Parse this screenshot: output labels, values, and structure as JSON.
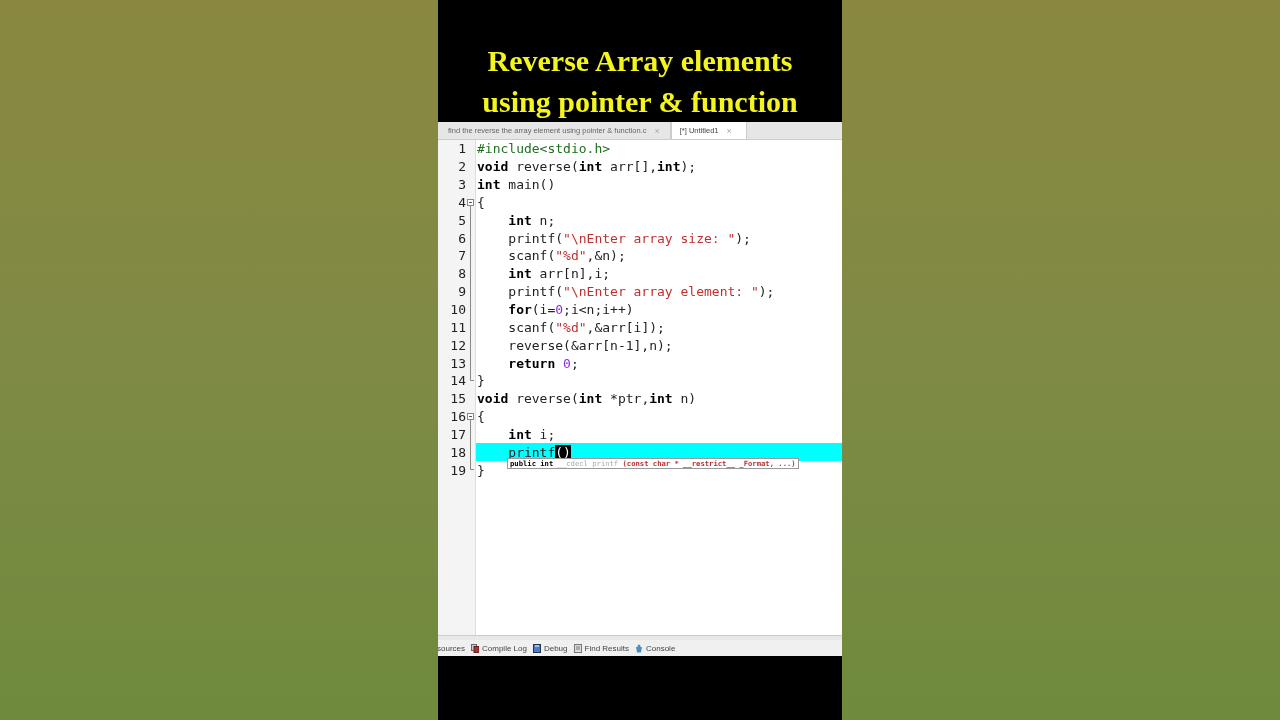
{
  "title_lines": [
    "Reverse Array elements",
    "using pointer & function"
  ],
  "editor_tabs": [
    {
      "label": "find the reverse the array element using pointer & function.c",
      "close": "×",
      "selected": false
    },
    {
      "label": "[*] Untitled1",
      "close": "×",
      "selected": true
    }
  ],
  "code_lines": [
    {
      "number": "1",
      "kind": "plain",
      "highlighted": false,
      "tokens": [
        {
          "kind": "pp",
          "text": "#include<stdio.h>"
        }
      ]
    },
    {
      "number": "2",
      "kind": "plain",
      "highlighted": false,
      "tokens": [
        {
          "kind": "kw",
          "text": "void"
        },
        {
          "kind": "plain",
          "text": " reverse("
        },
        {
          "kind": "kw",
          "text": "int"
        },
        {
          "kind": "plain",
          "text": " arr[],"
        },
        {
          "kind": "kw",
          "text": "int"
        },
        {
          "kind": "plain",
          "text": ");"
        }
      ]
    },
    {
      "number": "3",
      "kind": "plain",
      "highlighted": false,
      "tokens": [
        {
          "kind": "kw",
          "text": "int"
        },
        {
          "kind": "plain",
          "text": " main()"
        }
      ]
    },
    {
      "number": "4",
      "kind": "fold-start",
      "highlighted": false,
      "tokens": [
        {
          "kind": "plain",
          "text": "{"
        }
      ]
    },
    {
      "number": "5",
      "kind": "fold-body",
      "highlighted": false,
      "tokens": [
        {
          "kind": "kw",
          "text": "    int"
        },
        {
          "kind": "plain",
          "text": " n;"
        }
      ]
    },
    {
      "number": "6",
      "kind": "fold-body",
      "highlighted": false,
      "tokens": [
        {
          "kind": "plain",
          "text": "    printf("
        },
        {
          "kind": "str",
          "text": "\"\\nEnter array size: \""
        },
        {
          "kind": "plain",
          "text": ");"
        }
      ]
    },
    {
      "number": "7",
      "kind": "fold-body",
      "highlighted": false,
      "tokens": [
        {
          "kind": "plain",
          "text": "    scanf("
        },
        {
          "kind": "str",
          "text": "\"%d\""
        },
        {
          "kind": "plain",
          "text": ",&n);"
        }
      ]
    },
    {
      "number": "8",
      "kind": "fold-body",
      "highlighted": false,
      "tokens": [
        {
          "kind": "kw",
          "text": "    int"
        },
        {
          "kind": "plain",
          "text": " arr[n],i;"
        }
      ]
    },
    {
      "number": "9",
      "kind": "fold-body",
      "highlighted": false,
      "tokens": [
        {
          "kind": "plain",
          "text": "    printf("
        },
        {
          "kind": "str",
          "text": "\"\\nEnter array element: \""
        },
        {
          "kind": "plain",
          "text": ");"
        }
      ]
    },
    {
      "number": "10",
      "kind": "fold-body",
      "highlighted": false,
      "tokens": [
        {
          "kind": "kw",
          "text": "    for"
        },
        {
          "kind": "plain",
          "text": "(i="
        },
        {
          "kind": "num",
          "text": "0"
        },
        {
          "kind": "plain",
          "text": ";i<n;i++)"
        }
      ]
    },
    {
      "number": "11",
      "kind": "fold-body",
      "highlighted": false,
      "tokens": [
        {
          "kind": "plain",
          "text": "    scanf("
        },
        {
          "kind": "str",
          "text": "\"%d\""
        },
        {
          "kind": "plain",
          "text": ",&arr[i]);"
        }
      ]
    },
    {
      "number": "12",
      "kind": "fold-body",
      "highlighted": false,
      "tokens": [
        {
          "kind": "plain",
          "text": "    reverse(&arr[n-1],n);"
        }
      ]
    },
    {
      "number": "13",
      "kind": "fold-body",
      "highlighted": false,
      "tokens": [
        {
          "kind": "kw",
          "text": "    return "
        },
        {
          "kind": "num",
          "text": "0"
        },
        {
          "kind": "plain",
          "text": ";"
        }
      ]
    },
    {
      "number": "14",
      "kind": "fold-end",
      "highlighted": false,
      "tokens": [
        {
          "kind": "plain",
          "text": "}"
        }
      ]
    },
    {
      "number": "15",
      "kind": "plain",
      "highlighted": false,
      "tokens": [
        {
          "kind": "kw",
          "text": "void"
        },
        {
          "kind": "plain",
          "text": " reverse("
        },
        {
          "kind": "kw",
          "text": "int"
        },
        {
          "kind": "plain",
          "text": " *ptr,"
        },
        {
          "kind": "kw",
          "text": "int"
        },
        {
          "kind": "plain",
          "text": " n)"
        }
      ]
    },
    {
      "number": "16",
      "kind": "fold-start",
      "highlighted": false,
      "tokens": [
        {
          "kind": "plain",
          "text": "{"
        }
      ]
    },
    {
      "number": "17",
      "kind": "fold-body",
      "highlighted": false,
      "tokens": [
        {
          "kind": "kw",
          "text": "    int"
        },
        {
          "kind": "plain",
          "text": " i;"
        }
      ]
    },
    {
      "number": "18",
      "kind": "fold-body",
      "highlighted": true,
      "tokens": [
        {
          "kind": "plain",
          "text": "    printf"
        },
        {
          "kind": "cursor",
          "text": "()"
        }
      ],
      "tooltip": [
        {
          "kind": "kw",
          "text": "public int"
        },
        {
          "kind": "faint",
          "text": " __cdecl printf "
        },
        {
          "kind": "str",
          "text": "(const char * __restrict__ _Format, ...)"
        }
      ]
    },
    {
      "number": "19",
      "kind": "fold-end",
      "highlighted": false,
      "tokens": [
        {
          "kind": "plain",
          "text": "}"
        }
      ]
    }
  ],
  "bottom_tabs": [
    {
      "label": "sources"
    },
    {
      "label": "Compile Log"
    },
    {
      "label": "Debug"
    },
    {
      "label": "Find Results"
    },
    {
      "label": "Console"
    }
  ]
}
